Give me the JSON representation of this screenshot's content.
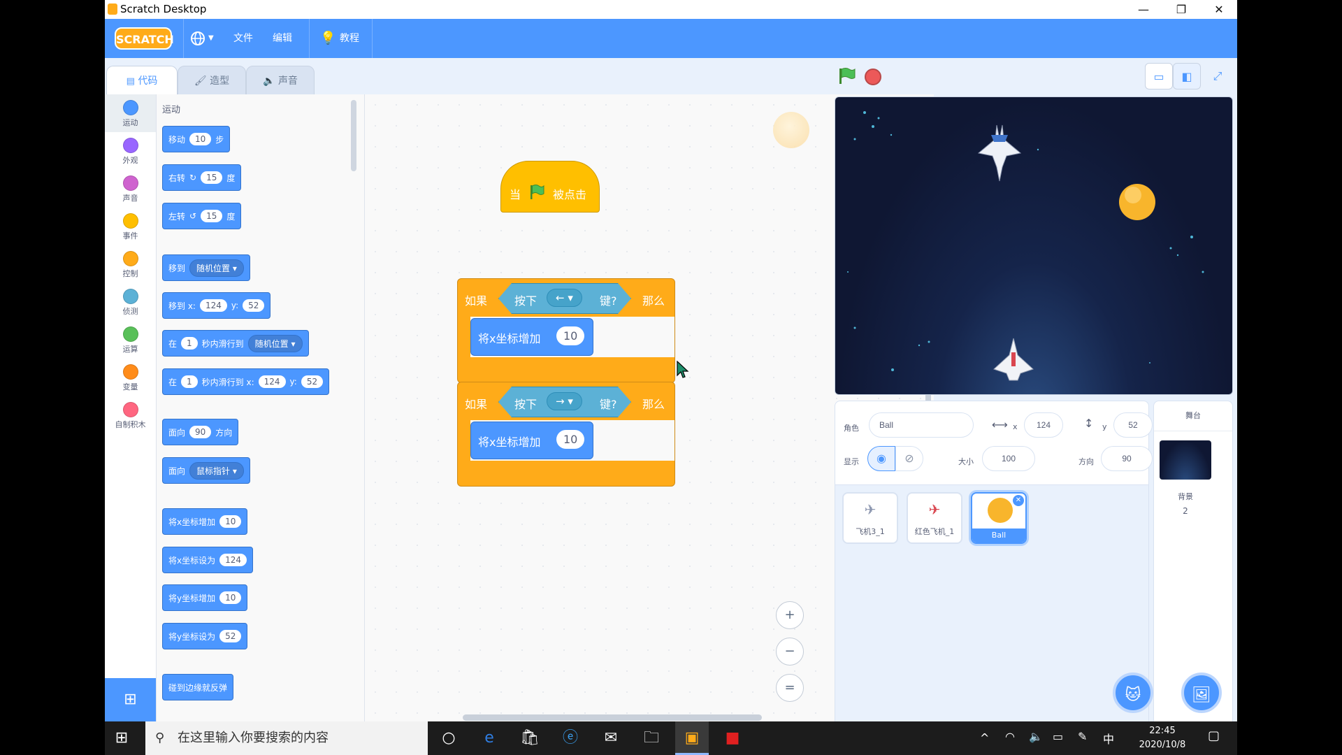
{
  "window": {
    "title": "Scratch Desktop",
    "controls": [
      "—",
      "❐",
      "✕"
    ]
  },
  "menubar": {
    "logo": "SCRATCH",
    "language_icon": "globe-icon",
    "file": "文件",
    "edit": "编辑",
    "tutorials": "教程"
  },
  "tabs": {
    "code": "代码",
    "costumes": "造型",
    "sounds": "声音"
  },
  "categories": [
    {
      "label": "运动",
      "color": "#4c97ff"
    },
    {
      "label": "外观",
      "color": "#9966ff"
    },
    {
      "label": "声音",
      "color": "#cf63cf"
    },
    {
      "label": "事件",
      "color": "#ffbf00"
    },
    {
      "label": "控制",
      "color": "#ffab19"
    },
    {
      "label": "侦测",
      "color": "#5cb1d6"
    },
    {
      "label": "运算",
      "color": "#59c059"
    },
    {
      "label": "变量",
      "color": "#ff8c1a"
    },
    {
      "label": "自制积木",
      "color": "#ff6680"
    }
  ],
  "palette": {
    "title": "运动",
    "move": {
      "a": "移动",
      "v": "10",
      "b": "步"
    },
    "turn_right": {
      "a": "右转",
      "v": "15",
      "b": "度"
    },
    "turn_left": {
      "a": "左转",
      "v": "15",
      "b": "度"
    },
    "goto": {
      "a": "移到",
      "dd": "随机位置 ▾"
    },
    "goto_xy": {
      "a": "移到 x:",
      "x": "124",
      "b": "y:",
      "y": "52"
    },
    "glide": {
      "a": "在",
      "v": "1",
      "b": "秒内滑行到",
      "dd": "随机位置 ▾"
    },
    "glide_xy": {
      "a": "在",
      "v": "1",
      "b": "秒内滑行到 x:",
      "x": "124",
      "c": "y:",
      "y": "52"
    },
    "point_dir": {
      "a": "面向",
      "v": "90",
      "b": "方向"
    },
    "point_towards": {
      "a": "面向",
      "dd": "鼠标指针 ▾"
    },
    "change_x": {
      "a": "将x坐标增加",
      "v": "10"
    },
    "set_x": {
      "a": "将x坐标设为",
      "v": "124"
    },
    "change_y": {
      "a": "将y坐标增加",
      "v": "10"
    },
    "set_y": {
      "a": "将y坐标设为",
      "v": "52"
    },
    "bounce": "碰到边缘就反弹"
  },
  "script": {
    "hat": {
      "a": "当",
      "b": "被点击"
    },
    "if1": {
      "if": "如果",
      "press": "按下",
      "key": "← ▾",
      "key_q": "键?",
      "then": "那么",
      "body": "将x坐标增加",
      "v": "10"
    },
    "if2": {
      "if": "如果",
      "press": "按下",
      "key": "→ ▾",
      "key_q": "键?",
      "then": "那么",
      "body": "将x坐标增加",
      "v": "10"
    }
  },
  "zoom": {
    "in": "+",
    "out": "−",
    "reset": "="
  },
  "sprite_info": {
    "sprite_label": "角色",
    "sprite_name": "Ball",
    "x_label": "x",
    "x": "124",
    "y_label": "y",
    "y": "52",
    "show_label": "显示",
    "size_label": "大小",
    "size": "100",
    "direction_label": "方向",
    "direction": "90"
  },
  "sprites": [
    {
      "name": "飞机3_1",
      "selected": false
    },
    {
      "name": "红色飞机_1",
      "selected": false
    },
    {
      "name": "Ball",
      "selected": true
    }
  ],
  "stage_panel": {
    "title": "舞台",
    "backdrop_label": "背景",
    "backdrop_count": "2"
  },
  "taskbar": {
    "search_placeholder": "在这里输入你要搜索的内容",
    "ime": "中",
    "time": "22:45",
    "date": "2020/10/8"
  }
}
